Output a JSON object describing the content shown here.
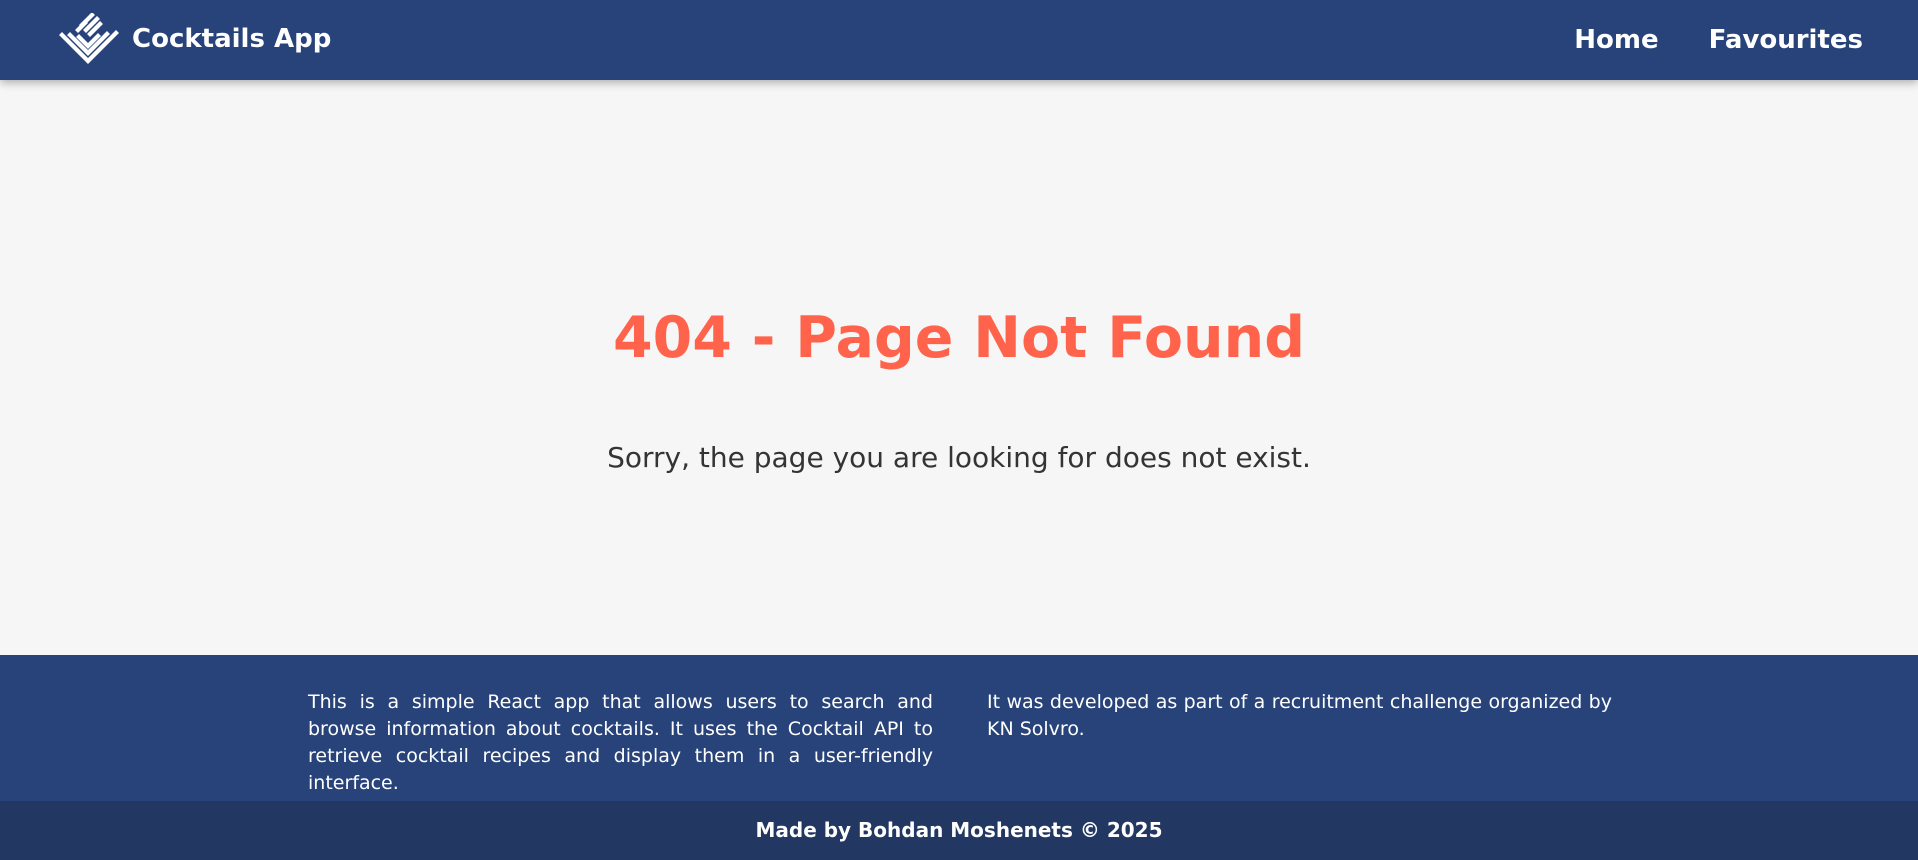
{
  "header": {
    "app_title": "Cocktails App",
    "nav": [
      {
        "label": "Home"
      },
      {
        "label": "Favourites"
      }
    ]
  },
  "error_page": {
    "title": "404 - Page Not Found",
    "message": "Sorry, the page you are looking for does not exist."
  },
  "footer": {
    "description_left": "This is a simple React app that allows users to search and browse information about cocktails. It uses the Cocktail API to retrieve cocktail recipes and display them in a user-friendly interface.",
    "description_right": "It was developed as part of a recruitment challenge organized by KN Solvro.",
    "copyright": "Made by Bohdan Moshenets © 2025"
  },
  "colors": {
    "header_background": "#27437a",
    "page_background": "#f6f6f6",
    "error_title": "#ff634b",
    "footer_bottom": "#223761",
    "text_light": "#ffffff"
  },
  "icons": {
    "brand_logo": "cocktail-logo-icon"
  }
}
